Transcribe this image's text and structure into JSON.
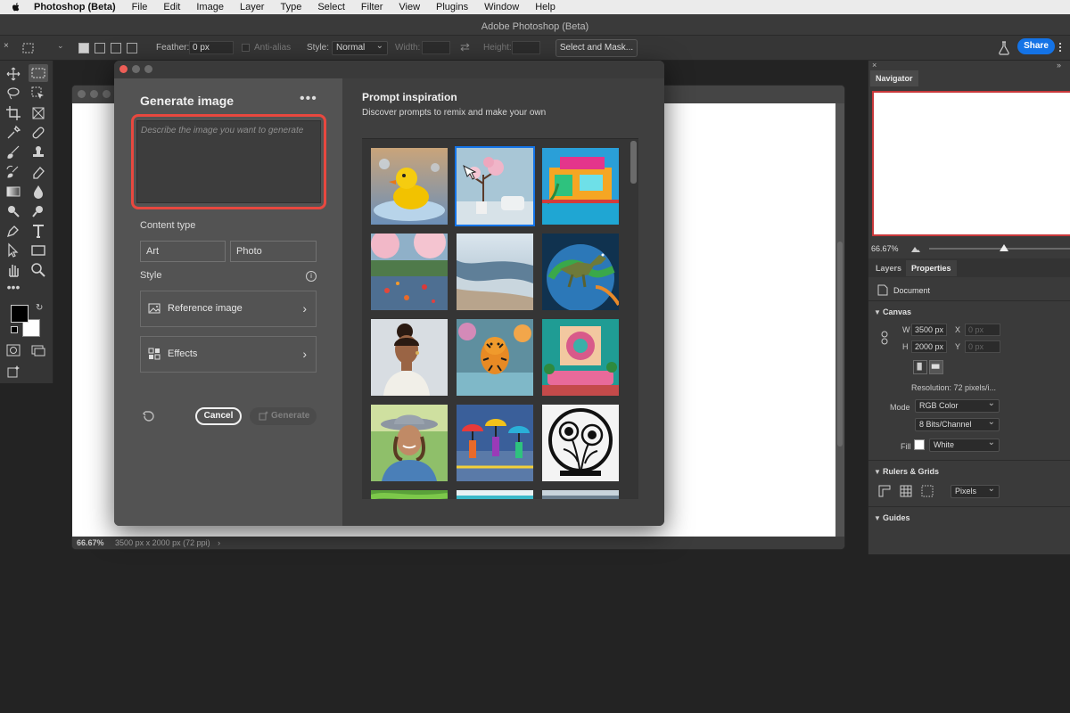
{
  "menubar": {
    "app": "Photoshop (Beta)",
    "items": [
      "File",
      "Edit",
      "Image",
      "Layer",
      "Type",
      "Select",
      "Filter",
      "View",
      "Plugins",
      "Window",
      "Help"
    ]
  },
  "window_title": "Adobe Photoshop (Beta)",
  "options": {
    "feather_label": "Feather:",
    "feather_value": "0 px",
    "antialias_label": "Anti-alias",
    "style_label": "Style:",
    "style_value": "Normal",
    "width_label": "Width:",
    "height_label": "Height:",
    "select_mask_label": "Select and Mask...",
    "share_label": "Share"
  },
  "document": {
    "zoom": "66.67%",
    "size_info": "3500 px x 2000 px (72 ppi)"
  },
  "dialog": {
    "title": "Generate image",
    "more_label": "•••",
    "prompt_placeholder": "Describe the image you want to generate",
    "content_type_label": "Content type",
    "content_types": [
      "Art",
      "Photo"
    ],
    "style_label": "Style",
    "info_glyph": "i",
    "reference_image_label": "Reference image",
    "effects_label": "Effects",
    "cancel_label": "Cancel",
    "generate_label": "Generate"
  },
  "inspiration": {
    "title": "Prompt inspiration",
    "subtitle": "Discover prompts to remix and make your own",
    "thumbnails": [
      "rubber-duck",
      "cherry-blossom-room",
      "colorful-house",
      "autumn-river",
      "beach-waves",
      "dinosaur-globe",
      "woman-portrait",
      "tiger-water",
      "teal-living-room",
      "woman-hat",
      "umbrella-painting",
      "peony-emblem"
    ]
  },
  "navigator": {
    "tab": "Navigator",
    "zoom": "66.67%"
  },
  "properties": {
    "tabs": [
      "Layers",
      "Properties"
    ],
    "document_label": "Document",
    "canvas_label": "Canvas",
    "w_label": "W",
    "w_value": "3500 px",
    "h_label": "H",
    "h_value": "2000 px",
    "x_label": "X",
    "x_value": "0 px",
    "y_label": "Y",
    "y_value": "0 px",
    "resolution": "Resolution: 72 pixels/i...",
    "mode_label": "Mode",
    "mode_value": "RGB Color",
    "bits_value": "8 Bits/Channel",
    "fill_label": "Fill",
    "fill_value": "White",
    "rulers_label": "Rulers & Grids",
    "units_value": "Pixels",
    "guides_label": "Guides"
  },
  "colors": {
    "accent": "#1473e6",
    "highlight": "#e8483f"
  }
}
